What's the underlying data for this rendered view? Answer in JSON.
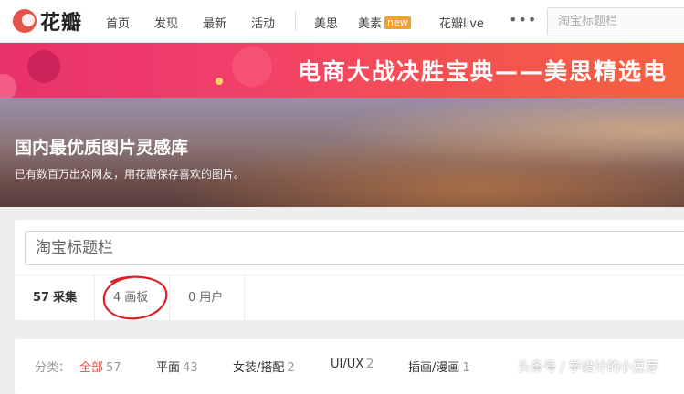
{
  "nav": {
    "logo_text": "花瓣",
    "items": [
      "首页",
      "发现",
      "最新",
      "活动"
    ],
    "extra_items": [
      "美思",
      "美素",
      "花瓣live"
    ],
    "new_badge": "new",
    "more": "•••",
    "search_placeholder": "淘宝标题栏"
  },
  "banner": {
    "text": "电商大战决胜宝典——美思精选电"
  },
  "hero": {
    "title": "国内最优质图片灵感库",
    "subtitle": "已有数百万出众网友，用花瓣保存喜欢的图片。"
  },
  "search": {
    "value": "淘宝标题栏",
    "tabs": [
      {
        "count": "57",
        "label": "采集"
      },
      {
        "count": "4",
        "label": "画板"
      },
      {
        "count": "0",
        "label": "用户"
      }
    ]
  },
  "categories": {
    "label": "分类：",
    "items": [
      {
        "name": "全部",
        "count": "57"
      },
      {
        "name": "平面",
        "count": "43"
      },
      {
        "name": "女装/搭配",
        "count": "2"
      },
      {
        "name": "UI/UX",
        "count": "2"
      },
      {
        "name": "插画/漫画",
        "count": "1"
      }
    ]
  },
  "watermark": "头条号 / 学设计的小豆芽",
  "colors": {
    "brand_red": "#e5534b",
    "annotation_red": "#d9232a",
    "new_badge": "#f0a030"
  }
}
